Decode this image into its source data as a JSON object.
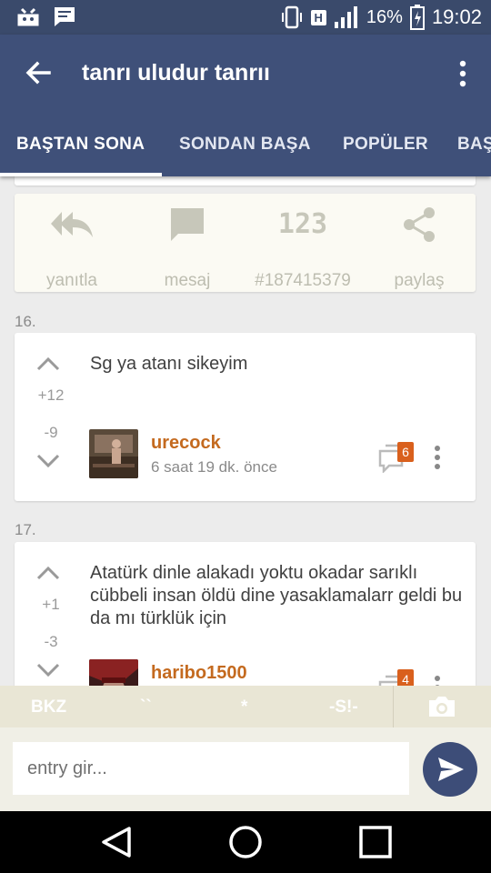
{
  "status_bar": {
    "battery": "16%",
    "time": "19:02",
    "network": "H"
  },
  "app_bar": {
    "title": "tanrı uludur tanrıı"
  },
  "tabs": [
    {
      "label": "BAŞTAN SONA"
    },
    {
      "label": "SONDAN BAŞA"
    },
    {
      "label": "POPÜLER"
    },
    {
      "label": "BAŞ"
    }
  ],
  "actions": [
    {
      "icon": "reply-all-icon",
      "label": "yanıtla"
    },
    {
      "icon": "message-icon",
      "label": "mesaj"
    },
    {
      "icon": "number-123-icon",
      "label": "#187415379"
    },
    {
      "icon": "share-icon",
      "label": "paylaş"
    }
  ],
  "entries": [
    {
      "index": "16.",
      "upvotes": "+12",
      "downvotes": "-9",
      "text": "Sg ya atanı sikeyim",
      "author": "urecock",
      "time": "6 saat 19 dk. önce",
      "comment_count": "6"
    },
    {
      "index": "17.",
      "upvotes": "+1",
      "downvotes": "-3",
      "text": "Atatürk dinle alakadı yoktu okadar sarıklı cübbeli insan öldü dine yasaklamalarr geldi bu da mı türklük için",
      "author": "haribo1500",
      "time": "",
      "comment_count": "4"
    }
  ],
  "format_bar": {
    "bkz": "BKZ",
    "backtick": "``",
    "star": "*",
    "spoiler": "-S!-"
  },
  "input": {
    "placeholder": "entry gir..."
  },
  "colors": {
    "primary": "#3f5079",
    "accent": "#d9601d",
    "author": "#c46a1f"
  }
}
